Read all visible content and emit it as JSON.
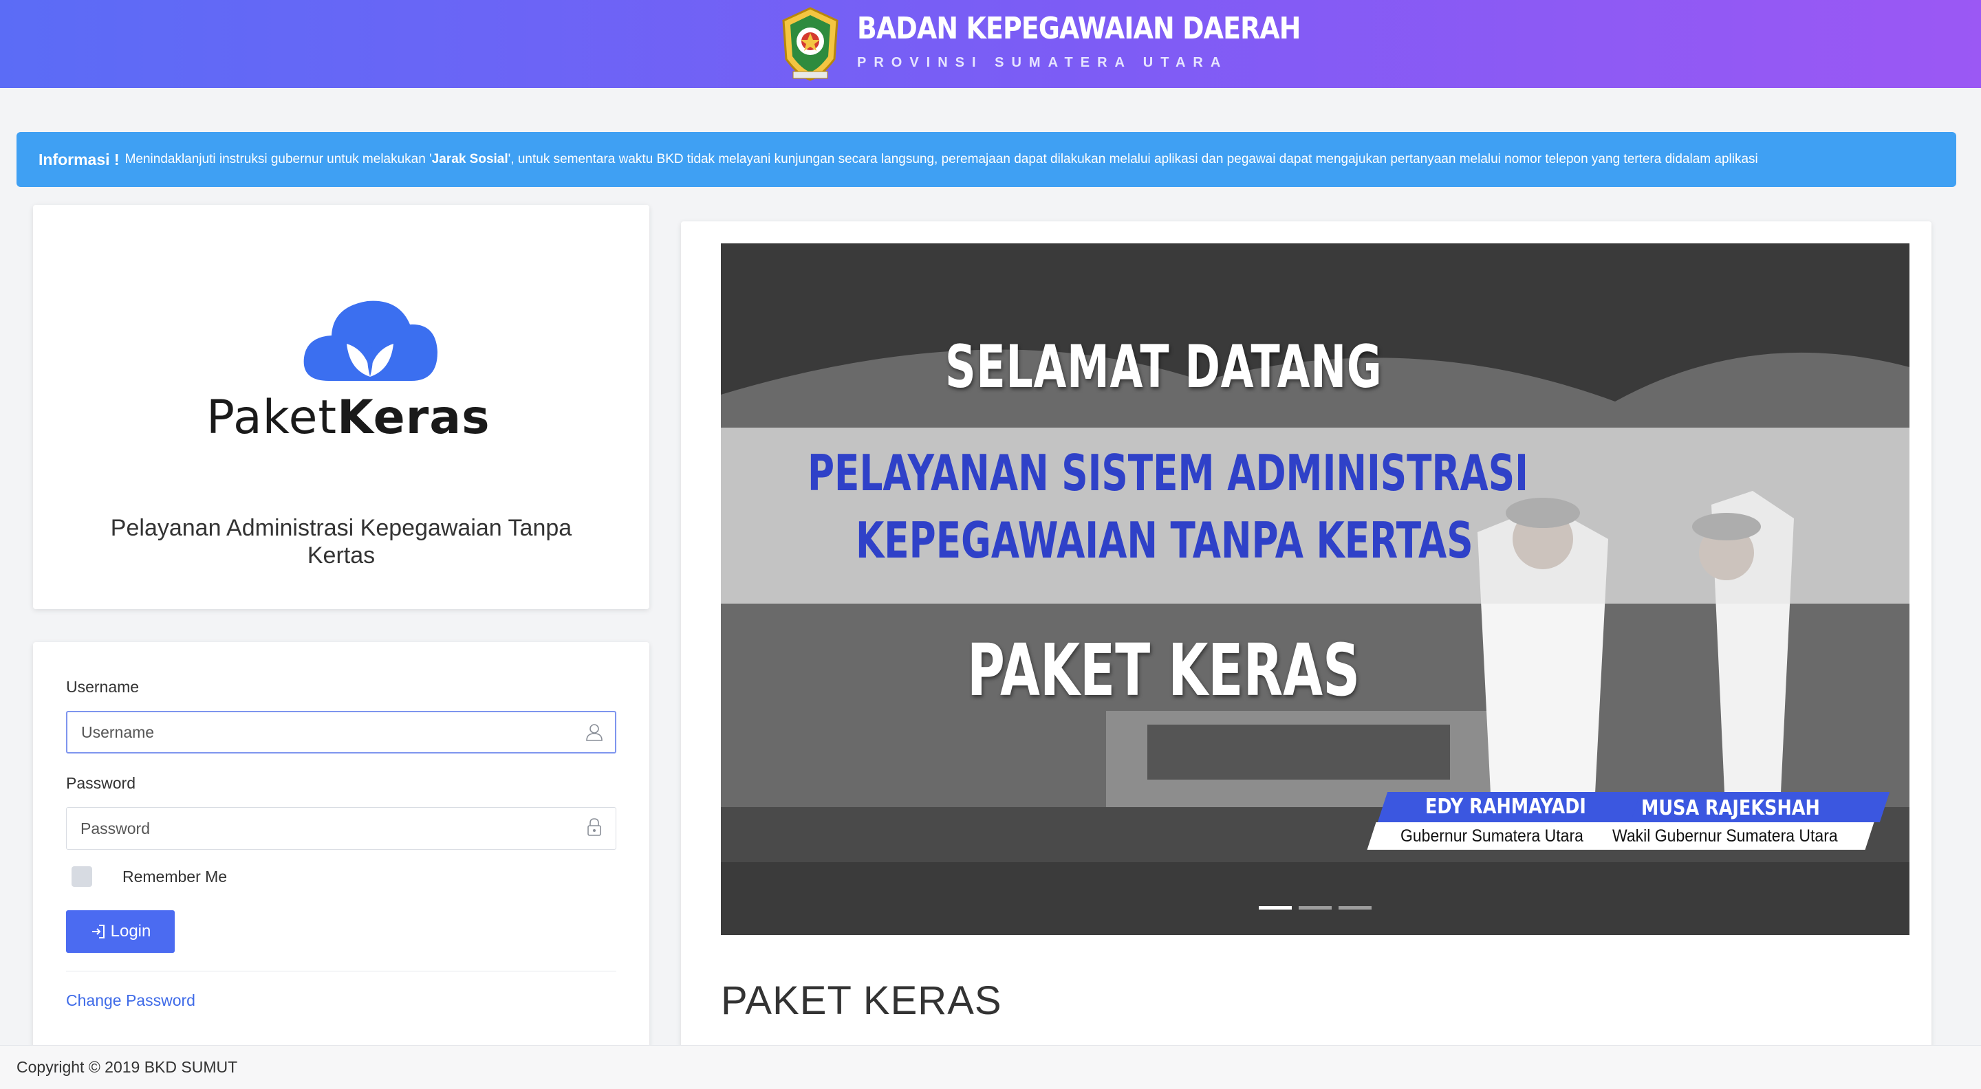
{
  "header": {
    "title": "BADAN KEPEGAWAIAN DAERAH",
    "subtitle": "PROVINSI SUMATERA UTARA",
    "colors": {
      "gradient_start": "#5b6cf6",
      "gradient_end": "#9b58f4"
    }
  },
  "alert": {
    "label": "Informasi !",
    "message_before": "Menindaklanjuti instruksi gubernur untuk melakukan '",
    "message_bold": "Jarak Sosial",
    "message_after": "', untuk sementara waktu BKD tidak melayani kunjungan secara langsung, peremajaan dapat dilakukan melalui aplikasi dan pegawai dapat mengajukan pertanyaan melalui nomor telepon yang tertera didalam aplikasi",
    "color": "#3fa0f3"
  },
  "logo": {
    "word_light": "Paket",
    "word_bold": "Keras",
    "tagline": "Pelayanan Administrasi Kepegawaian Tanpa Kertas",
    "icon": "cloud-leaf-icon"
  },
  "login": {
    "username_label": "Username",
    "username_placeholder": "Username",
    "username_value": "",
    "password_label": "Password",
    "password_placeholder": "Password",
    "password_value": "",
    "remember_label": "Remember Me",
    "remember_checked": false,
    "button_label": "Login",
    "change_password": "Change Password",
    "accent": "#4b6bf1"
  },
  "carousel": {
    "welcome": "SELAMAT DATANG",
    "line1": "PELAYANAN SISTEM ADMINISTRASI",
    "line2": "KEPEGAWAIAN TANPA KERTAS",
    "banner": "PAKET KERAS",
    "person1_name": "EDY RAHMAYADI",
    "person1_role": "Gubernur Sumatera Utara",
    "person2_name": "MUSA RAJEKSHAH",
    "person2_role": "Wakil Gubernur Sumatera Utara",
    "slides": 3,
    "active_slide": 1
  },
  "content": {
    "section_title": "PAKET KERAS"
  },
  "footer": {
    "copyright": "Copyright © 2019 BKD SUMUT"
  }
}
